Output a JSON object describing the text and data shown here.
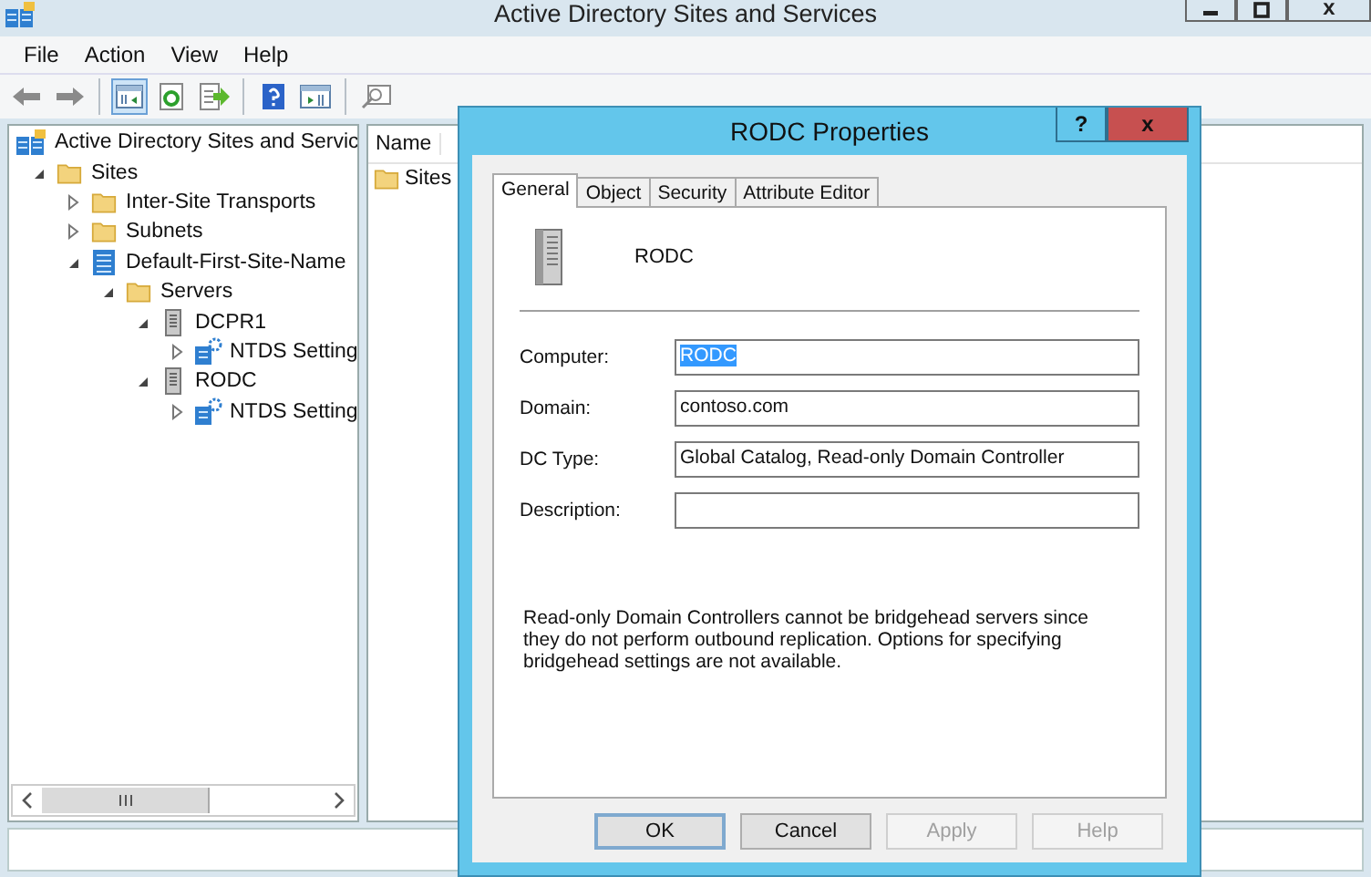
{
  "window": {
    "title": "Active Directory Sites and Services",
    "close_glyph": "x"
  },
  "menu": [
    "File",
    "Action",
    "View",
    "Help"
  ],
  "toolbar": [
    [
      {
        "kind": "back",
        "pressed": false
      },
      {
        "kind": "forward",
        "pressed": false
      }
    ],
    [
      {
        "kind": "tree",
        "pressed": true
      },
      {
        "kind": "refresh",
        "pressed": false
      },
      {
        "kind": "export",
        "pressed": false
      }
    ],
    [
      {
        "kind": "help",
        "pressed": false
      },
      {
        "kind": "action_pane",
        "pressed": false
      }
    ],
    [
      {
        "kind": "find",
        "pressed": false
      }
    ]
  ],
  "tree": {
    "label": "Active Directory Sites and Servic",
    "kind": "root",
    "children": [
      {
        "label": "Sites",
        "kind": "folder",
        "expanded": true,
        "children": [
          {
            "label": "Inter-Site Transports",
            "kind": "folder",
            "expanded": false
          },
          {
            "label": "Subnets",
            "kind": "folder",
            "expanded": false
          },
          {
            "label": "Default-First-Site-Name",
            "kind": "site",
            "expanded": true,
            "children": [
              {
                "label": "Servers",
                "kind": "folder",
                "expanded": true,
                "children": [
                  {
                    "label": "DCPR1",
                    "kind": "server",
                    "expanded": true,
                    "children": [
                      {
                        "label": "NTDS Setting",
                        "kind": "ntds",
                        "expanded": false
                      }
                    ]
                  },
                  {
                    "label": "RODC",
                    "kind": "server",
                    "expanded": true,
                    "children": [
                      {
                        "label": "NTDS Setting",
                        "kind": "ntds",
                        "expanded": false
                      }
                    ]
                  }
                ]
              }
            ]
          }
        ]
      }
    ]
  },
  "list": {
    "columns": [
      "Name"
    ],
    "rows": [
      {
        "label": "Sites",
        "kind": "folder"
      }
    ]
  },
  "dialog": {
    "title": "RODC Properties",
    "help_glyph": "?",
    "close_glyph": "x",
    "tabs": [
      {
        "label": "General",
        "selected": true
      },
      {
        "label": "Object",
        "selected": false
      },
      {
        "label": "Security",
        "selected": false
      },
      {
        "label": "Attribute Editor",
        "selected": false
      }
    ],
    "object_name": "RODC",
    "fields": [
      {
        "label": "Computer:",
        "value": "RODC",
        "highlighted": true
      },
      {
        "label": "Domain:",
        "value": "contoso.com",
        "highlighted": false
      },
      {
        "label": "DC Type:",
        "value": "Global Catalog, Read-only Domain Controller",
        "highlighted": false
      },
      {
        "label": "Description:"
      }
    ],
    "note": "Read-only Domain Controllers cannot be bridgehead servers since they do not perform outbound replication. Options for specifying bridgehead settings are not available.",
    "buttons": [
      {
        "label": "OK",
        "default": true,
        "disabled": false
      },
      {
        "label": "Cancel",
        "default": false,
        "disabled": false
      },
      {
        "label": "Apply",
        "default": false,
        "disabled": true
      },
      {
        "label": "Help",
        "default": false,
        "disabled": true
      }
    ]
  }
}
